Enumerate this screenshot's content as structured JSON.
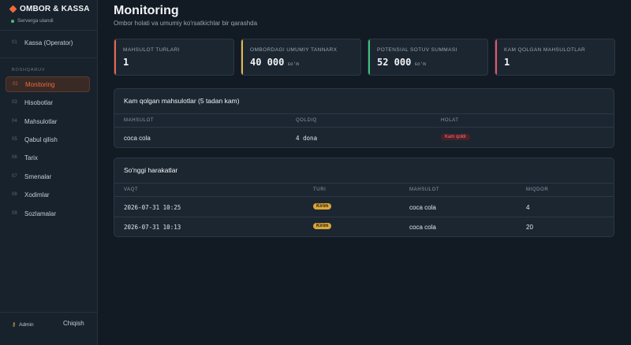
{
  "app": {
    "brand": "OMBOR & KASSA",
    "server_status": "Serverga ulandi"
  },
  "sidebar": {
    "top_item": {
      "num": "01",
      "label": "Kassa (Operator)"
    },
    "section_label": "BOSHQARUV",
    "items": [
      {
        "num": "02",
        "label": "Monitoring",
        "active": true
      },
      {
        "num": "03",
        "label": "Hisobotlar"
      },
      {
        "num": "04",
        "label": "Mahsulotlar"
      },
      {
        "num": "05",
        "label": "Qabul qilish"
      },
      {
        "num": "06",
        "label": "Tarix"
      },
      {
        "num": "07",
        "label": "Smenalar"
      },
      {
        "num": "08",
        "label": "Xodimlar"
      },
      {
        "num": "09",
        "label": "Sozlamalar"
      }
    ],
    "user": {
      "icon": "key-icon",
      "name": "Admin"
    },
    "logout": "Chiqish"
  },
  "page": {
    "title": "Monitoring",
    "subtitle": "Ombor holati va umumiy ko'rsatkichlar bir qarashda"
  },
  "cards": [
    {
      "label": "MAHSULOT TURLARI",
      "value": "1",
      "unit": "",
      "accent": "#e8664a"
    },
    {
      "label": "OMBORDAGI UMUMIY TANNARX",
      "value": "40 000",
      "unit": "so'm",
      "accent": "#e5b84a"
    },
    {
      "label": "POTENSIAL SOTUV SUMMASI",
      "value": "52 000",
      "unit": "so'm",
      "accent": "#3ec27a"
    },
    {
      "label": "KAM QOLGAN MAHSULOTLAR",
      "value": "1",
      "unit": "",
      "accent": "#e8546a"
    }
  ],
  "low_stock": {
    "title": "Kam qolgan mahsulotlar (5 tadan kam)",
    "columns": [
      "MAHSULOT",
      "QOLDIQ",
      "HOLAT"
    ],
    "rows": [
      {
        "product": "coca cola",
        "qty": "4 dona",
        "status": "Kam qoldi"
      }
    ]
  },
  "recent": {
    "title": "So'nggi harakatlar",
    "columns": [
      "VAQT",
      "TURI",
      "MAHSULOT",
      "MIQDOR"
    ],
    "rows": [
      {
        "time": "2026-07-31 10:25",
        "type": "Kirim",
        "product": "coca cola",
        "qty": "4"
      },
      {
        "time": "2026-07-31 10:13",
        "type": "Kirim",
        "product": "coca cola",
        "qty": "20"
      }
    ]
  },
  "colors": {
    "accent": "#f0683a",
    "background": "#121a23",
    "online": "#3ec27a",
    "low_stock_badge": "#ff6f7d",
    "kirim_badge": "#d9a63a"
  }
}
